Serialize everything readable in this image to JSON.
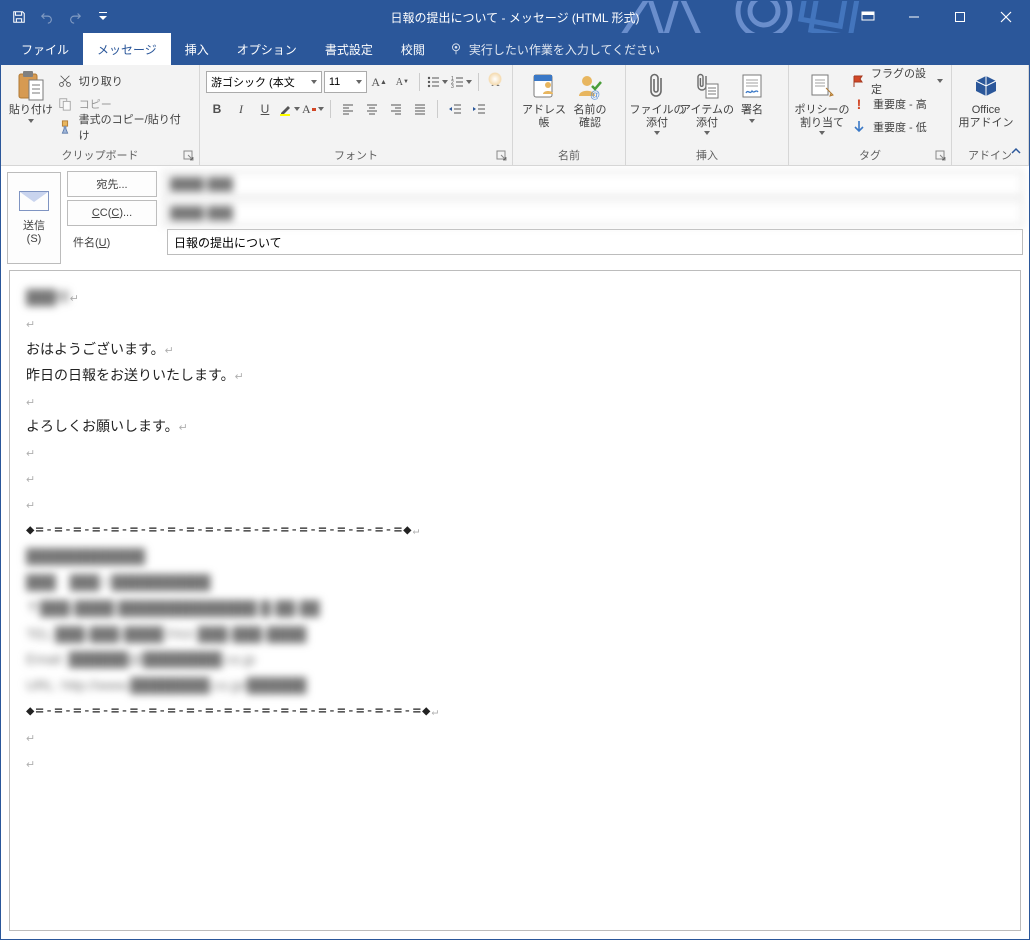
{
  "title": "日報の提出について  -  メッセージ (HTML 形式)",
  "tabs": {
    "file": "ファイル",
    "message": "メッセージ",
    "insert": "挿入",
    "options": "オプション",
    "format": "書式設定",
    "review": "校閲",
    "tellme": "実行したい作業を入力してください"
  },
  "ribbon": {
    "clipboard": {
      "paste": "貼り付け",
      "cut": "切り取り",
      "copy": "コピー",
      "formatpainter": "書式のコピー/貼り付け",
      "label": "クリップボード"
    },
    "font": {
      "name": "游ゴシック (本文",
      "size": "11",
      "label": "フォント"
    },
    "names": {
      "addressbook": "アドレス帳",
      "checknames": "名前の\n確認",
      "label": "名前"
    },
    "include": {
      "attachfile": "ファイルの\n添付",
      "attachitem": "アイテムの\n添付",
      "signature": "署名",
      "label": "挿入"
    },
    "tags": {
      "policy": "ポリシーの\n割り当て",
      "followup": "フラグの設定",
      "highimp": "重要度 - 高",
      "lowimp": "重要度 - 低",
      "label": "タグ"
    },
    "addins": {
      "officeaddins": "Office\n用アドイン",
      "label": "アドイン"
    }
  },
  "fields": {
    "send": "送信\n(S)",
    "to_btn": "宛先...",
    "cc_btn": "C C(C)...",
    "subject_lbl": "件名(U)",
    "to_val": "████ ███",
    "cc_val": "████ ███",
    "subject_val": "日報の提出について"
  },
  "body": {
    "greeting_redacted": "███様",
    "line_hello": "おはようございます。",
    "line_report": "昨日の日報をお送りいたします。",
    "line_please": "よろしくお願いします。",
    "sig_sep_top": "◆=-=-=-=-=-=-=-=-=-=-=-=-=-=-=-=-=-=-=-=◆",
    "sig_l1": "████████████",
    "sig_l2": "███　███ / ██████████",
    "sig_l3": "〒███-████ ██████████████ █-██-██",
    "sig_l4": "TEL ███-███-████ FAX ███-███-████",
    "sig_l5": "Email: ██████@████████.co.jp",
    "sig_l6": "URL: http://www.████████.co.jp/██████",
    "sig_sep_bot": "◆=-=-=-=-=-=-=-=-=-=-=-=-=-=-=-=-=-=-=-=-=◆"
  }
}
